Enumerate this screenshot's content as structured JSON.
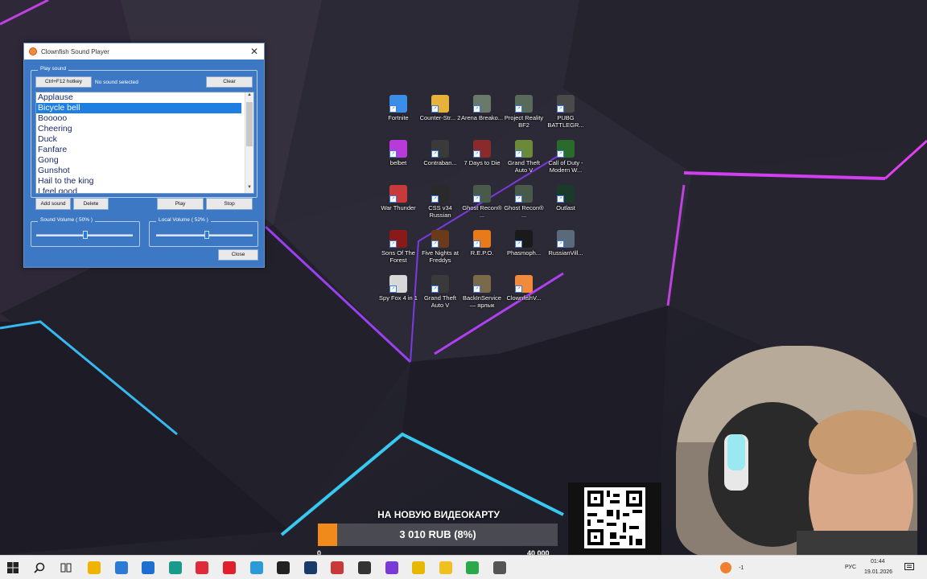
{
  "window": {
    "title": "Clownfish Sound Player",
    "play_sound_legend": "Play sound",
    "hotkey_button": "Ctrl+F12 hotkey",
    "status": "No sound selected",
    "clear_button": "Clear",
    "sounds": [
      "Applause",
      "Bicycle bell",
      "Booooo",
      "Cheering",
      "Duck",
      "Fanfare",
      "Gong",
      "Gunshot",
      "Hail to the king",
      "I feel good"
    ],
    "selected_index": 1,
    "add_sound_button": "Add sound",
    "delete_button": "Delete",
    "play_button": "Play",
    "stop_button": "Stop",
    "sound_volume_label": "Sound Volume ( 50% )",
    "sound_volume": 0.5,
    "local_volume_label": "Local Volume ( 52% )",
    "local_volume": 0.52,
    "close_button": "Close"
  },
  "desktop_icons": [
    {
      "name": "Fortnite",
      "color": "#3a8ee8",
      "icon": "fortnite-icon"
    },
    {
      "name": "Counter-Str... 2",
      "color": "#e8b23a",
      "icon": "counter-strike-icon"
    },
    {
      "name": "Arena Breako...",
      "color": "#6a7a6a",
      "icon": "arena-breakout-icon"
    },
    {
      "name": "Project Reality BF2",
      "color": "#5a6a5a",
      "icon": "project-reality-icon"
    },
    {
      "name": "PUBG BATTLEGR...",
      "color": "#4a4a4a",
      "icon": "pubg-icon"
    },
    {
      "name": "belbet",
      "color": "#b83ad8",
      "icon": "belbet-icon"
    },
    {
      "name": "Contraban...",
      "color": "#3a3a3a",
      "icon": "contraband-icon"
    },
    {
      "name": "7 Days to Die",
      "color": "#8a2a2a",
      "icon": "seven-days-icon"
    },
    {
      "name": "Grand Theft Auto V",
      "color": "#6a8a3a",
      "icon": "gta-icon"
    },
    {
      "name": "Call of Duty - Modern W...",
      "color": "#2a6a2a",
      "icon": "cod-icon"
    },
    {
      "name": "War Thunder",
      "color": "#c83a3a",
      "icon": "war-thunder-icon"
    },
    {
      "name": "CSS v34 Russian",
      "color": "#2a2a2a",
      "icon": "css-icon"
    },
    {
      "name": "Ghost Recon® ...",
      "color": "#4a5a4a",
      "icon": "ghost-recon-icon"
    },
    {
      "name": "Ghost Recon® ...",
      "color": "#4a5a4a",
      "icon": "ghost-recon-icon"
    },
    {
      "name": "Outlast",
      "color": "#1a3a2a",
      "icon": "outlast-icon"
    },
    {
      "name": "Sons Of The Forest",
      "color": "#8a1a1a",
      "icon": "sons-forest-icon"
    },
    {
      "name": "Five Nights at Freddys",
      "color": "#6a3a1a",
      "icon": "fnaf-icon"
    },
    {
      "name": "R.E.P.O.",
      "color": "#e87a1a",
      "icon": "repo-icon"
    },
    {
      "name": "Phasmoph...",
      "color": "#1a1a1a",
      "icon": "phasmophobia-icon"
    },
    {
      "name": "RussianVill...",
      "color": "#5a6a7a",
      "icon": "russian-village-icon"
    },
    {
      "name": "Spy Fox 4 in 1",
      "color": "#d8d8d8",
      "icon": "spy-fox-icon"
    },
    {
      "name": "Grand Theft Auto V",
      "color": "#3a3a3a",
      "icon": "gta-icon"
    },
    {
      "name": "BackInService — ярлык",
      "color": "#7a6a4a",
      "icon": "back-in-service-icon"
    },
    {
      "name": "ClownfishV...",
      "color": "#f28a3c",
      "icon": "clownfish-icon"
    }
  ],
  "donation": {
    "title": "НА НОВУЮ ВИДЕОКАРТУ",
    "amount": "3 010 RUB (8%)",
    "progress": 0.08,
    "min": "0",
    "max": "40 000"
  },
  "taskbar": {
    "items": [
      {
        "icon": "file-explorer-icon",
        "color": "#f0b400"
      },
      {
        "icon": "store-icon",
        "color": "#2a7ad6"
      },
      {
        "icon": "mail-icon",
        "color": "#1f6fd0"
      },
      {
        "icon": "edge-icon",
        "color": "#1a9a8a"
      },
      {
        "icon": "opera-gx-icon",
        "color": "#e02a3a"
      },
      {
        "icon": "opera-icon",
        "color": "#e0202a"
      },
      {
        "icon": "telegram-icon",
        "color": "#2a9ad8"
      },
      {
        "icon": "epic-games-icon",
        "color": "#222222"
      },
      {
        "icon": "steam-icon",
        "color": "#1a3a6a"
      },
      {
        "icon": "tf-icon",
        "color": "#c83a3a"
      },
      {
        "icon": "app-icon",
        "color": "#333333"
      },
      {
        "icon": "app2-icon",
        "color": "#7a3ad8"
      },
      {
        "icon": "coin-icon",
        "color": "#e8b800"
      },
      {
        "icon": "sun-icon",
        "color": "#f0c020"
      },
      {
        "icon": "green-app-icon",
        "color": "#2aa84a"
      },
      {
        "icon": "gear-icon",
        "color": "#555555"
      }
    ],
    "language": "РУС",
    "time": "01:44",
    "date": "19.01.2026",
    "tray_temp": "-1"
  }
}
